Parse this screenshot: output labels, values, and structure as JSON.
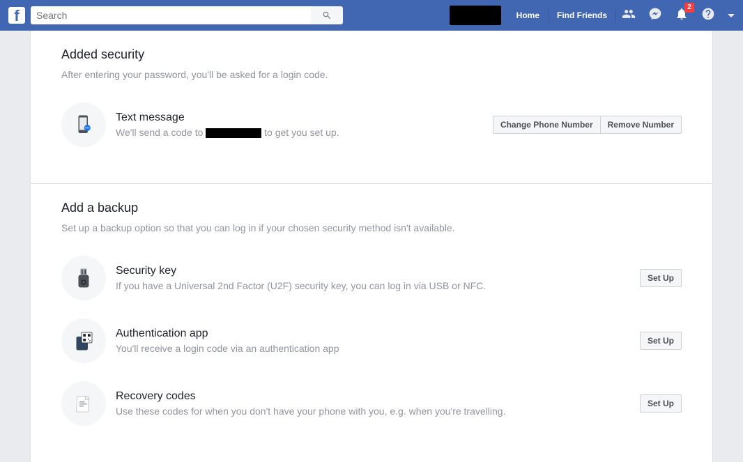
{
  "header": {
    "search_placeholder": "Search",
    "nav": {
      "home": "Home",
      "find_friends": "Find Friends"
    },
    "notification_count": "2"
  },
  "added_security": {
    "title": "Added security",
    "desc": "After entering your password, you'll be asked for a login code.",
    "text_message": {
      "title": "Text message",
      "desc_prefix": "We'll send a code to ",
      "desc_suffix": " to get you set up.",
      "change_btn": "Change Phone Number",
      "remove_btn": "Remove Number"
    }
  },
  "add_backup": {
    "title": "Add a backup",
    "desc": "Set up a backup option so that you can log in if your chosen security method isn't available.",
    "security_key": {
      "title": "Security key",
      "desc": "If you have a Universal 2nd Factor (U2F) security key, you can log in via USB or NFC.",
      "btn": "Set Up"
    },
    "auth_app": {
      "title": "Authentication app",
      "desc": "You'll receive a login code via an authentication app",
      "btn": "Set Up"
    },
    "recovery_codes": {
      "title": "Recovery codes",
      "desc": "Use these codes for when you don't have your phone with you, e.g. when you're travelling.",
      "btn": "Set Up"
    }
  }
}
